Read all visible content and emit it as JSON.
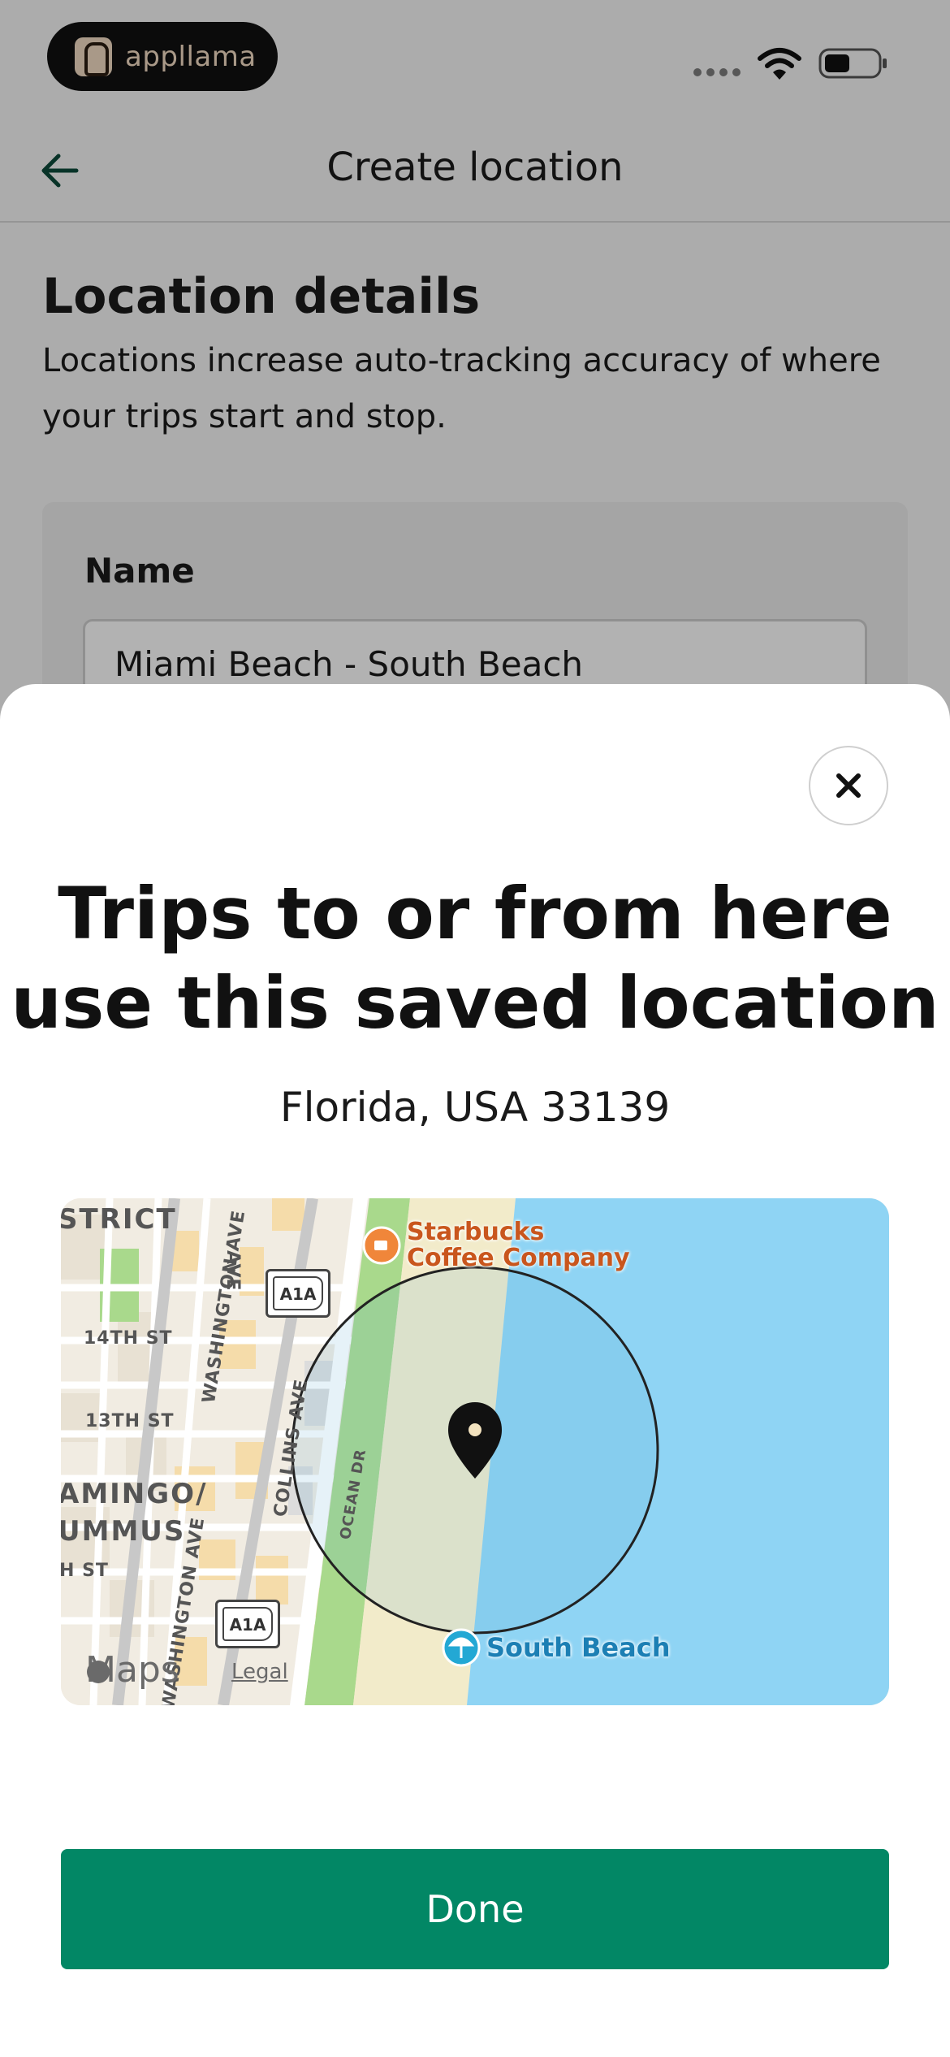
{
  "status_bar": {
    "brand_name": "appllama",
    "icons": [
      "signal-dots-icon",
      "wifi-icon",
      "battery-icon"
    ]
  },
  "nav": {
    "title": "Create location",
    "back_icon": "arrow-left-icon"
  },
  "details": {
    "title": "Location details",
    "description": "Locations increase auto-tracking accuracy of where your trips start and stop."
  },
  "form": {
    "name_label": "Name",
    "name_value": "Miami Beach - South Beach"
  },
  "sheet": {
    "close_icon": "close-icon",
    "title": "Trips to or from here use this saved location",
    "address": "Florida, USA 33139",
    "done_label": "Done"
  },
  "map": {
    "labels": {
      "district_1": "STRICT",
      "district_2": "AMINGO/",
      "district_3": "UMMUS",
      "street_14th": "14TH ST",
      "street_13th": "13TH ST",
      "street_h": "H ST",
      "street_washington_1": "WASHINGTON AVE",
      "street_washington_2": "WASHINGTON AVE",
      "street_collins": "COLLINS AVE",
      "street_ocean": "OCEAN DR",
      "street_ave_top": "AVE",
      "shield_1": "A1A",
      "shield_2": "A1A",
      "poi_starbucks_1": "Starbucks",
      "poi_starbucks_2": "Coffee Company",
      "poi_beach": "South Beach",
      "maps_brand": "Maps",
      "legal": "Legal"
    },
    "colors": {
      "water": "#8fd4f4",
      "sand": "#f2ebca",
      "park": "#a9d98c",
      "accent_button": "#028765"
    }
  }
}
